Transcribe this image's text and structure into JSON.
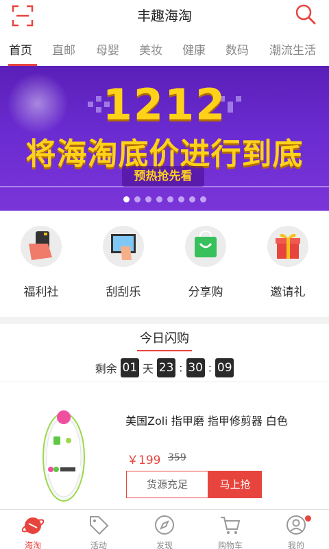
{
  "header": {
    "title": "丰趣海淘",
    "scan_icon": "scan-icon",
    "search_icon": "search-icon"
  },
  "tabs": [
    {
      "label": "首页",
      "active": true
    },
    {
      "label": "直邮"
    },
    {
      "label": "母婴"
    },
    {
      "label": "美妆"
    },
    {
      "label": "健康"
    },
    {
      "label": "数码"
    },
    {
      "label": "潮流生活"
    }
  ],
  "banner": {
    "headline": "1212",
    "slogan": "将海淘底价进行到底",
    "sub": "预热抢先看",
    "slide_count": 8,
    "active_slide": 1
  },
  "shortcuts": [
    {
      "label": "福利社",
      "icon": "welfare-icon"
    },
    {
      "label": "刮刮乐",
      "icon": "scratch-card-icon"
    },
    {
      "label": "分享购",
      "icon": "share-bag-icon"
    },
    {
      "label": "邀请礼",
      "icon": "gift-icon"
    }
  ],
  "flash_sale": {
    "title": "今日闪购",
    "countdown": {
      "prefix": "剩余",
      "days": "01",
      "day_unit": "天",
      "hours": "23",
      "minutes": "30",
      "seconds": "09",
      "separator": ":"
    },
    "product": {
      "name": "美国Zoli 指甲磨 指甲修剪器 白色",
      "price": "￥199",
      "original_price": "359",
      "stock_label": "货源充足",
      "buy_label": "马上抢"
    }
  },
  "bottom_nav": [
    {
      "label": "海淘",
      "icon": "planet-icon",
      "active": true
    },
    {
      "label": "活动",
      "icon": "tag-icon"
    },
    {
      "label": "发现",
      "icon": "compass-icon"
    },
    {
      "label": "购物车",
      "icon": "cart-icon"
    },
    {
      "label": "我的",
      "icon": "user-icon",
      "has_badge": true
    }
  ],
  "colors": {
    "accent": "#e8443e",
    "banner": "#6a2bd0",
    "banner_text": "#ffd21a"
  }
}
